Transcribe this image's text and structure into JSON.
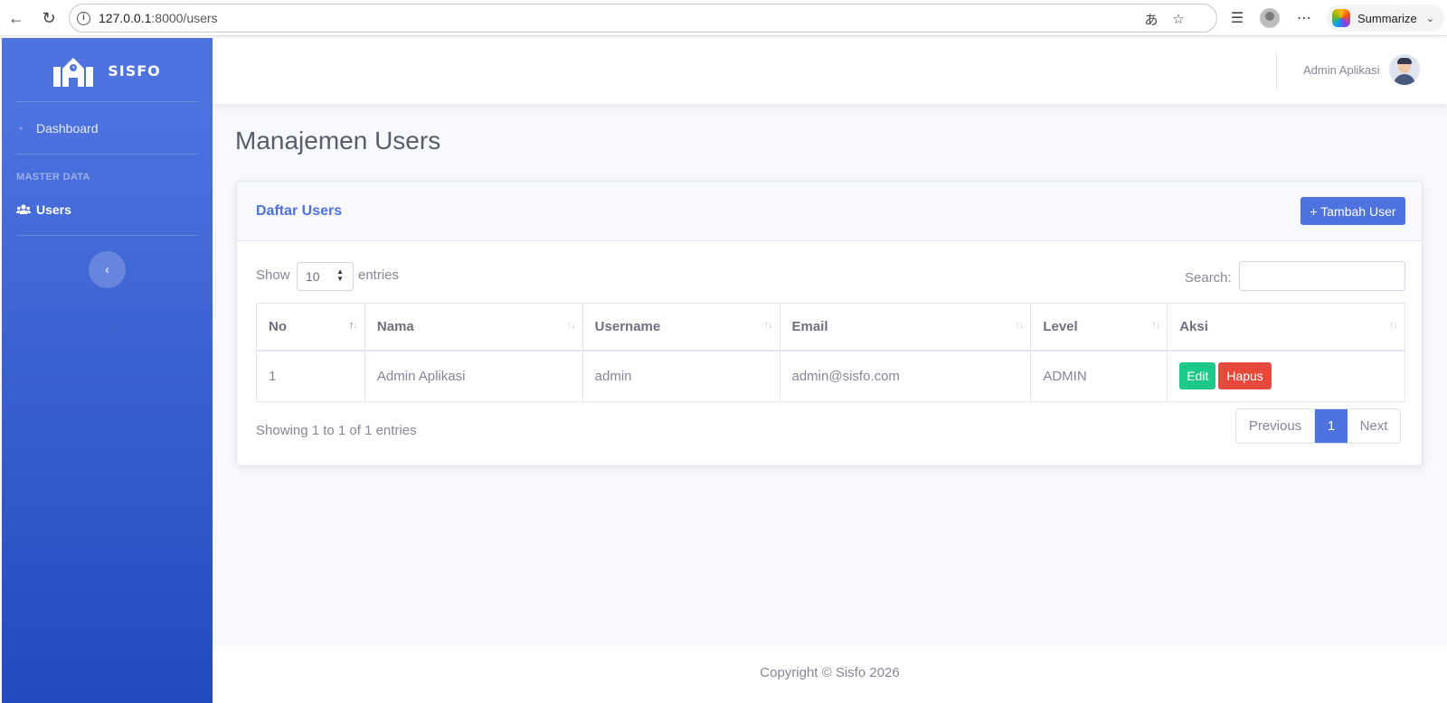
{
  "browser": {
    "url_host": "127.0.0.1",
    "url_path": ":8000/users",
    "summarize_label": "Summarize"
  },
  "sidebar": {
    "brand": "SISFO",
    "heading": "MASTER DATA",
    "items": [
      {
        "label": "Dashboard",
        "icon": "tachometer-icon"
      },
      {
        "label": "Users",
        "icon": "users-icon"
      }
    ],
    "toggle_icon": "‹"
  },
  "topbar": {
    "user_name": "Admin Aplikasi"
  },
  "page": {
    "title": "Manajemen Users"
  },
  "card": {
    "title": "Daftar Users",
    "add_button": "+ Tambah User",
    "show_label": "Show",
    "length_value": "10",
    "entries_label": "entries",
    "search_label": "Search:",
    "search_value": ""
  },
  "table": {
    "columns": [
      "No",
      "Nama",
      "Username",
      "Email",
      "Level",
      "Aksi"
    ],
    "rows": [
      {
        "no": "1",
        "nama": "Admin Aplikasi",
        "username": "admin",
        "email": "admin@sisfo.com",
        "level": "ADMIN",
        "edit": "Edit",
        "delete": "Hapus"
      }
    ],
    "info": "Showing 1 to 1 of 1 entries"
  },
  "pagination": {
    "previous": "Previous",
    "current": "1",
    "next": "Next"
  },
  "footer": {
    "copyright": "Copyright © Sisfo 2026"
  },
  "colors": {
    "primary": "#4e73df",
    "success": "#1cc88a",
    "danger": "#e74a3b"
  }
}
